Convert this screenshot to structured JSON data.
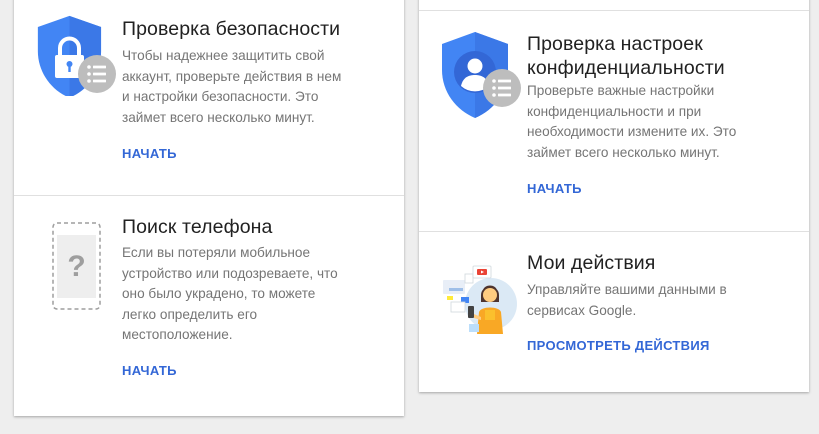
{
  "cards": [
    {
      "sections": [
        {
          "id": "security-checkup",
          "title": "Проверка безопасности",
          "description": "Чтобы надежнее защитить свой\nаккаунт, проверьте действия в нем\nи настройки безопасности. Это\nзаймет всего несколько минут.",
          "action": "НАЧАТЬ",
          "icon": "shield-lock-icon"
        },
        {
          "id": "find-phone",
          "title": "Поиск телефона",
          "description": "Если вы потеряли мобильное\nустройство или подозреваете, что\nоно было украдено, то можете\nлегко определить его\nместоположение.",
          "action": "НАЧАТЬ",
          "icon": "phone-question-icon"
        }
      ]
    },
    {
      "sections": [
        {
          "id": "privacy-checkup",
          "title": "Проверка настроек\nконфиденциальности",
          "description": "Проверьте важные настройки\nконфиденциальности и при\nнеобходимости измените их. Это\nзаймет всего несколько минут.",
          "action": "НАЧАТЬ",
          "icon": "shield-person-icon"
        },
        {
          "id": "my-activity",
          "title": "Мои действия",
          "description": "Управляйте вашими данными в\nсервисах Google.",
          "action": "ПРОСМОТРЕТЬ ДЕЙСТВИЯ",
          "icon": "activity-illustration-icon"
        }
      ]
    }
  ],
  "colors": {
    "shield_blue": "#4285f4",
    "shield_dark": "#3367d6",
    "badge_gray": "#bdbdbd",
    "link_blue": "#3367d6",
    "title": "#212121",
    "text": "#757575"
  }
}
